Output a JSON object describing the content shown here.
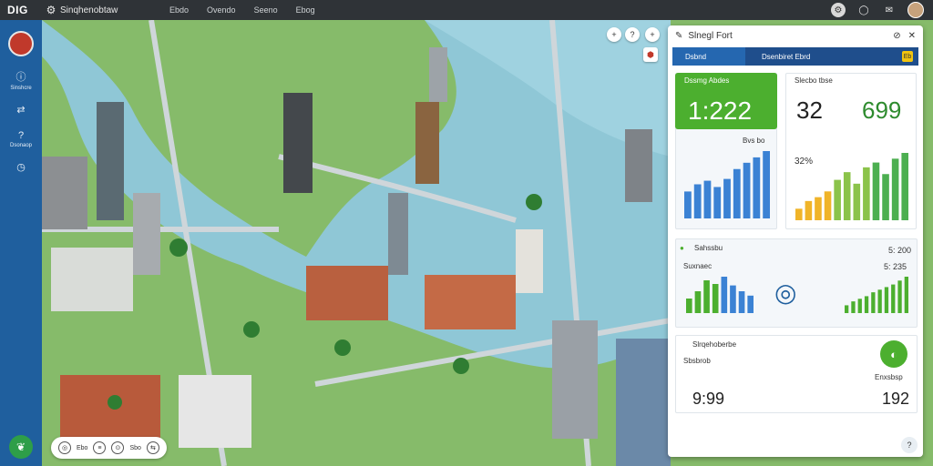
{
  "app": {
    "logo": "DIG",
    "title": "Sinqhenobtaw",
    "menu": [
      "Ebdo",
      "Ovendo",
      "Seeno",
      "Ebog"
    ]
  },
  "leftnav": {
    "items": [
      {
        "label": "Sinshcre",
        "icon": "info-icon"
      },
      {
        "label": "",
        "icon": "shuffle-icon"
      },
      {
        "label": "Dsonaop",
        "icon": "help-icon"
      },
      {
        "label": "",
        "icon": "clock-icon"
      }
    ]
  },
  "map": {
    "controls": [
      "+",
      "?",
      "+"
    ],
    "toolbar": [
      "Ebo",
      "Sbo"
    ]
  },
  "panel": {
    "title": "Slnegl Fort",
    "tabs": [
      "Dsbnd",
      "Dsenbiret Ebrd",
      "Eb"
    ],
    "kpi1": {
      "label": "Dssmg Abdes",
      "value": "1:222"
    },
    "kpi2": {
      "label": "Slecbo tbse",
      "value_a": "32",
      "value_b": "699"
    },
    "chart1": {
      "label": "Bvs bo"
    },
    "chart2": {
      "label": "32%"
    },
    "section2": {
      "title": "Sahssbu",
      "right_label": "5: 200",
      "sublabel": "Suxnaec",
      "right_sub": "5: 235"
    },
    "section3": {
      "title": "Slrqehoberbe",
      "sublabel": "Sbsbrob",
      "value_a": "9:99",
      "right_sub": "Enxsbsp",
      "value_b": "192"
    }
  },
  "chart_data": [
    {
      "type": "bar",
      "values": [
        30,
        38,
        42,
        35,
        44,
        55,
        62,
        68,
        75
      ],
      "colors": [
        "#3b82d4"
      ]
    },
    {
      "type": "bar",
      "values": [
        12,
        20,
        24,
        30,
        42,
        50,
        38,
        55,
        60,
        48,
        64,
        70
      ],
      "colors": [
        "#f0b429",
        "#8bc34a",
        "#4caf50"
      ]
    },
    {
      "type": "bar",
      "values": [
        20,
        30,
        45,
        40,
        50,
        38,
        30,
        24
      ],
      "colors": [
        "#4caf2f",
        "#3b82d4"
      ]
    },
    {
      "type": "bar",
      "values": [
        12,
        18,
        22,
        26,
        32,
        36,
        40,
        44,
        50,
        56
      ],
      "colors": [
        "#4caf2f"
      ]
    }
  ]
}
